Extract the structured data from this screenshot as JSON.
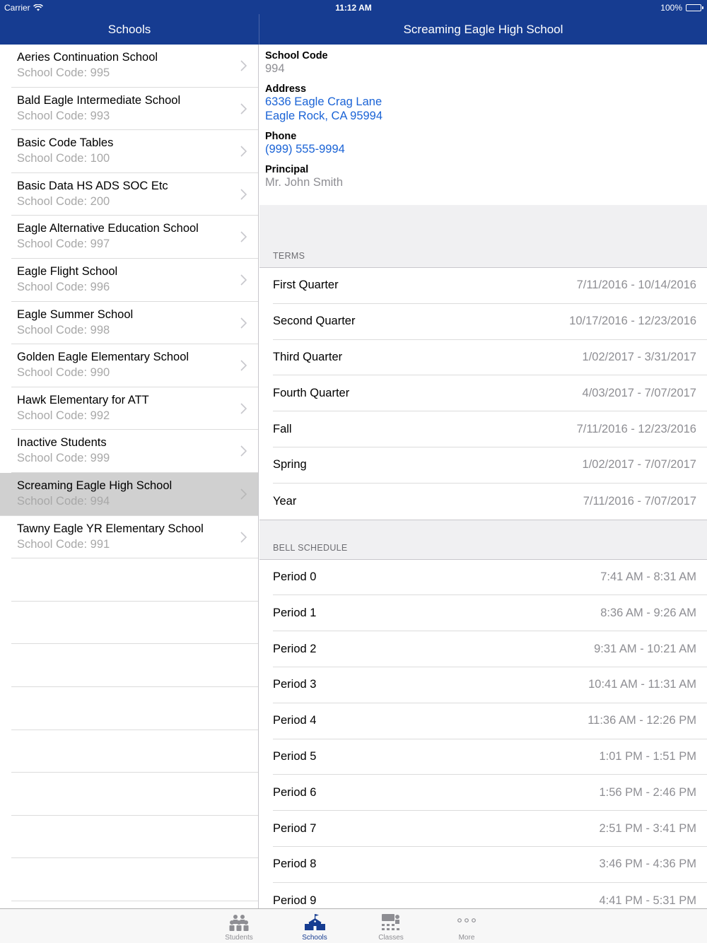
{
  "status_bar": {
    "carrier": "Carrier",
    "time": "11:12 AM",
    "battery": "100%"
  },
  "master": {
    "title": "Schools",
    "schools": [
      {
        "name": "Aeries Continuation School",
        "code": "School Code: 995"
      },
      {
        "name": "Bald Eagle Intermediate School",
        "code": "School Code: 993"
      },
      {
        "name": "Basic Code Tables",
        "code": "School Code: 100"
      },
      {
        "name": "Basic Data HS ADS SOC Etc",
        "code": "School Code: 200"
      },
      {
        "name": "Eagle Alternative Education School",
        "code": "School Code: 997"
      },
      {
        "name": "Eagle Flight School",
        "code": "School Code: 996"
      },
      {
        "name": "Eagle Summer School",
        "code": "School Code: 998"
      },
      {
        "name": "Golden Eagle Elementary School",
        "code": "School Code: 990"
      },
      {
        "name": "Hawk Elementary for ATT",
        "code": "School Code: 992"
      },
      {
        "name": "Inactive Students",
        "code": "School Code: 999"
      },
      {
        "name": "Screaming Eagle High School",
        "code": "School Code: 994",
        "selected": true
      },
      {
        "name": "Tawny Eagle YR Elementary School",
        "code": "School Code: 991"
      }
    ]
  },
  "detail": {
    "title": "Screaming Eagle High School",
    "school_code_label": "School Code",
    "school_code": "994",
    "address_label": "Address",
    "address_line1": "6336 Eagle Crag Lane",
    "address_line2": "Eagle Rock, CA  95994",
    "phone_label": "Phone",
    "phone": "(999) 555-9994",
    "principal_label": "Principal",
    "principal": "Mr. John Smith",
    "terms_header": "TERMS",
    "terms": [
      {
        "name": "First Quarter",
        "dates": "7/11/2016 - 10/14/2016"
      },
      {
        "name": "Second Quarter",
        "dates": "10/17/2016 - 12/23/2016"
      },
      {
        "name": "Third Quarter",
        "dates": "1/02/2017 - 3/31/2017"
      },
      {
        "name": "Fourth Quarter",
        "dates": "4/03/2017 - 7/07/2017"
      },
      {
        "name": "Fall",
        "dates": "7/11/2016 - 12/23/2016"
      },
      {
        "name": "Spring",
        "dates": "1/02/2017 - 7/07/2017"
      },
      {
        "name": "Year",
        "dates": "7/11/2016 - 7/07/2017"
      }
    ],
    "bell_header": "BELL SCHEDULE",
    "bell": [
      {
        "name": "Period 0",
        "time": "7:41 AM - 8:31 AM"
      },
      {
        "name": "Period 1",
        "time": "8:36 AM - 9:26 AM"
      },
      {
        "name": "Period 2",
        "time": "9:31 AM - 10:21 AM"
      },
      {
        "name": "Period 3",
        "time": "10:41 AM - 11:31 AM"
      },
      {
        "name": "Period 4",
        "time": "11:36 AM - 12:26 PM"
      },
      {
        "name": "Period 5",
        "time": "1:01 PM - 1:51 PM"
      },
      {
        "name": "Period 6",
        "time": "1:56 PM - 2:46 PM"
      },
      {
        "name": "Period 7",
        "time": "2:51 PM - 3:41 PM"
      },
      {
        "name": "Period 8",
        "time": "3:46 PM - 4:36 PM"
      },
      {
        "name": "Period 9",
        "time": "4:41 PM - 5:31 PM"
      }
    ]
  },
  "tabbar": {
    "tabs": [
      {
        "label": "Students",
        "icon": "students-icon"
      },
      {
        "label": "Schools",
        "icon": "school-building-icon",
        "active": true
      },
      {
        "label": "Classes",
        "icon": "classroom-icon"
      },
      {
        "label": "More",
        "icon": "more-dots-icon"
      }
    ]
  },
  "colors": {
    "nav": "#163c91",
    "link": "#1a63d6",
    "selected_row": "#d0d0d0",
    "tab_active": "#163c91",
    "tab_inactive": "#8e8e93"
  }
}
